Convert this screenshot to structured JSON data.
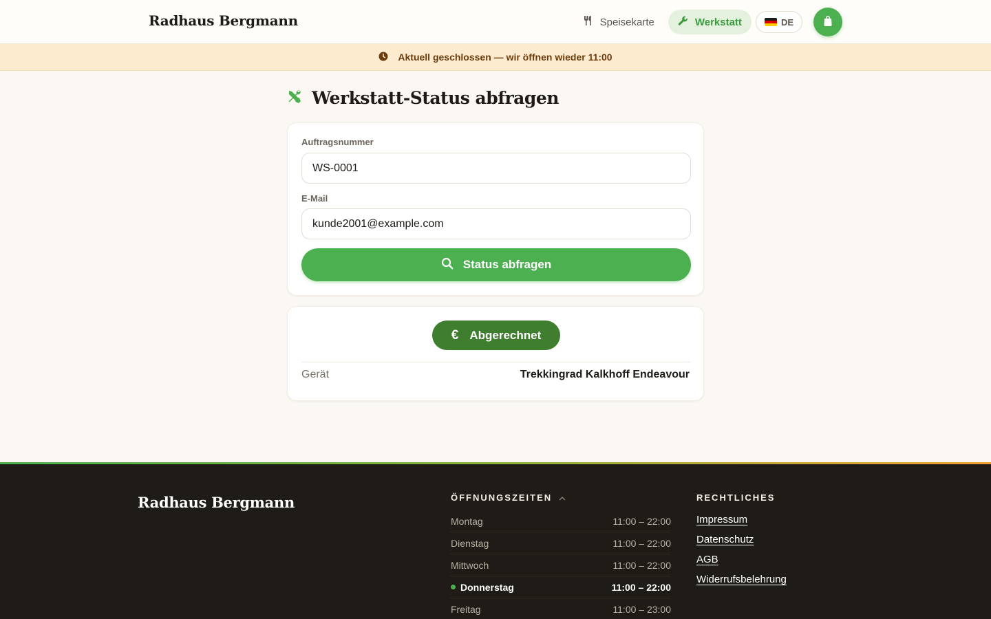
{
  "header": {
    "brand": "Radhaus Bergmann",
    "nav": [
      {
        "label": "Speisekarte",
        "icon": "utensils-icon",
        "active": false
      },
      {
        "label": "Werkstatt",
        "icon": "wrench-icon",
        "active": true
      }
    ],
    "language": {
      "label": "DE",
      "icon": "flag-de-icon"
    },
    "cart_icon": "shopping-bag-icon"
  },
  "banner": {
    "icon": "clock-icon",
    "text": "Aktuell geschlossen — wir öffnen wieder 11:00"
  },
  "main": {
    "title": "Werkstatt-Status abfragen",
    "title_icon": "tools-icon",
    "form": {
      "order_label": "Auftragsnummer",
      "order_value": "WS-0001",
      "email_label": "E-Mail",
      "email_value": "kunde2001@example.com",
      "submit_label": "Status abfragen",
      "submit_icon": "search-icon"
    },
    "result": {
      "status_label": "Abgerechnet",
      "status_icon": "euro-icon",
      "rows": [
        {
          "key": "Gerät",
          "value": "Trekkingrad Kalkhoff Endeavour"
        }
      ]
    }
  },
  "footer": {
    "brand": "Radhaus Bergmann",
    "hours": {
      "heading": "ÖFFNUNGSZEITEN",
      "rows": [
        {
          "day": "Montag",
          "time": "11:00 – 22:00",
          "today": false
        },
        {
          "day": "Dienstag",
          "time": "11:00 – 22:00",
          "today": false
        },
        {
          "day": "Mittwoch",
          "time": "11:00 – 22:00",
          "today": false
        },
        {
          "day": "Donnerstag",
          "time": "11:00 – 22:00",
          "today": true
        },
        {
          "day": "Freitag",
          "time": "11:00 – 23:00",
          "today": false
        }
      ]
    },
    "legal": {
      "heading": "RECHTLICHES",
      "links": [
        "Impressum",
        "Datenschutz",
        "AGB",
        "Widerrufsbelehrung"
      ]
    }
  },
  "colors": {
    "accent": "#4caf50",
    "status_pill": "#3f7e2e",
    "banner_bg": "#fdebd0",
    "banner_text": "#6b3d0c",
    "footer_bg": "#1f1b16"
  }
}
